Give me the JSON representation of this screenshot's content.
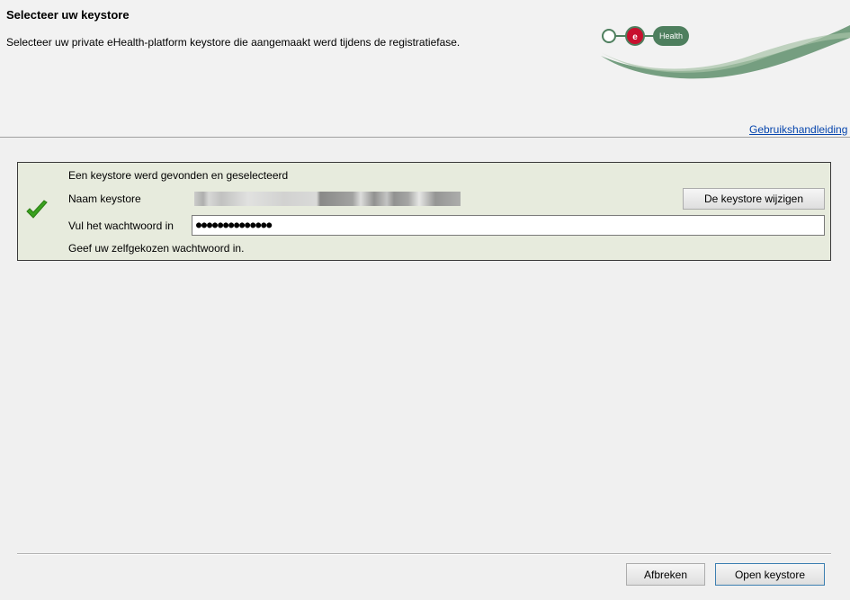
{
  "header": {
    "title": "Selecteer uw keystore",
    "subtitle": "Selecteer uw private eHealth-platform keystore die aangemaakt werd tijdens de registratiefase.",
    "logo": {
      "letter": "e",
      "name": "Health"
    },
    "help_link": "Gebruikshandleiding"
  },
  "panel": {
    "found_text": "Een keystore werd gevonden en geselecteerd",
    "name_label": "Naam keystore",
    "password_label": "Vul het wachtwoord in",
    "password_value": "●●●●●●●●●●●●●●",
    "hint": "Geef uw zelfgekozen wachtwoord in.",
    "change_button": "De keystore wijzigen",
    "status_icon": "checkmark-icon"
  },
  "footer": {
    "cancel_button": "Afbreken",
    "open_button": "Open keystore"
  },
  "colors": {
    "panel_bg": "#e7ebdd",
    "check_green": "#3aa11e",
    "logo_green": "#4e7f5e",
    "logo_red": "#c8102e",
    "link": "#0645ad"
  }
}
